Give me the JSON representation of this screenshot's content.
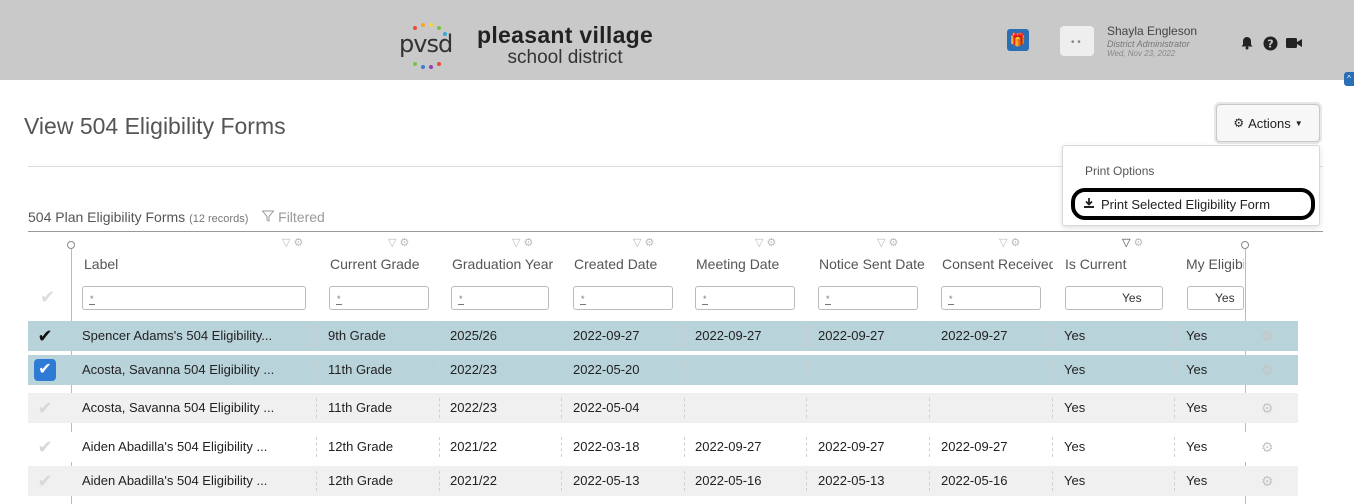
{
  "header": {
    "logo_short": "pvsd",
    "logo_line1": "pleasant village",
    "logo_line2": "school district",
    "user_name": "Shayla Engleson",
    "user_role": "District Administrator",
    "user_date": "Wed, Nov 23, 2022",
    "icons": [
      "gift-icon",
      "bell-icon",
      "help-icon",
      "video-icon"
    ]
  },
  "page": {
    "title": "View 504 Eligibility Forms",
    "actions_label": "Actions"
  },
  "dropdown": {
    "header": "Print Options",
    "item": "Print Selected Eligibility Form"
  },
  "grid": {
    "title": "504 Plan Eligibility Forms",
    "record_count": "(12 records)",
    "filtered_label": "Filtered",
    "columns": [
      {
        "label": "Label",
        "filter": ""
      },
      {
        "label": "Current Grade",
        "filter": ""
      },
      {
        "label": "Graduation Year",
        "filter": ""
      },
      {
        "label": "Created Date",
        "filter": ""
      },
      {
        "label": "Meeting Date",
        "filter": ""
      },
      {
        "label": "Notice Sent Date",
        "filter": ""
      },
      {
        "label": "Consent Received",
        "filter": ""
      },
      {
        "label": "Is Current",
        "filter": "Yes"
      },
      {
        "label": "My Eligibility",
        "filter": "Yes"
      }
    ],
    "rows": [
      {
        "label": "Spencer Adams's 504 Eligibility...",
        "grade": "9th Grade",
        "grad_year": "2025/26",
        "created": "2022-09-27",
        "meeting": "2022-09-27",
        "notice": "2022-09-27",
        "consent": "2022-09-27",
        "is_current": "Yes",
        "my_elig": "Yes",
        "selected": true,
        "check_style": "dark"
      },
      {
        "label": "Acosta, Savanna 504 Eligibility ...",
        "grade": "11th Grade",
        "grad_year": "2022/23",
        "created": "2022-05-20",
        "meeting": "",
        "notice": "",
        "consent": "",
        "is_current": "Yes",
        "my_elig": "Yes",
        "selected": true,
        "check_style": "blue"
      },
      {
        "label": "Acosta, Savanna 504 Eligibility ...",
        "grade": "11th Grade",
        "grad_year": "2022/23",
        "created": "2022-05-04",
        "meeting": "",
        "notice": "",
        "consent": "",
        "is_current": "Yes",
        "my_elig": "Yes",
        "selected": false,
        "check_style": "light"
      },
      {
        "label": "Aiden Abadilla's 504 Eligibility ...",
        "grade": "12th Grade",
        "grad_year": "2021/22",
        "created": "2022-03-18",
        "meeting": "2022-09-27",
        "notice": "2022-09-27",
        "consent": "2022-09-27",
        "is_current": "Yes",
        "my_elig": "Yes",
        "selected": false,
        "check_style": "light"
      },
      {
        "label": "Aiden Abadilla's 504 Eligibility ...",
        "grade": "12th Grade",
        "grad_year": "2021/22",
        "created": "2022-05-13",
        "meeting": "2022-05-16",
        "notice": "2022-05-13",
        "consent": "2022-05-16",
        "is_current": "Yes",
        "my_elig": "Yes",
        "selected": false,
        "check_style": "light"
      }
    ]
  },
  "colors": {
    "topbar": "#c9c9c9",
    "selected_row": "#b9d3da",
    "alt_row": "#f0f0f0",
    "accent_blue": "#2e7bd6"
  }
}
